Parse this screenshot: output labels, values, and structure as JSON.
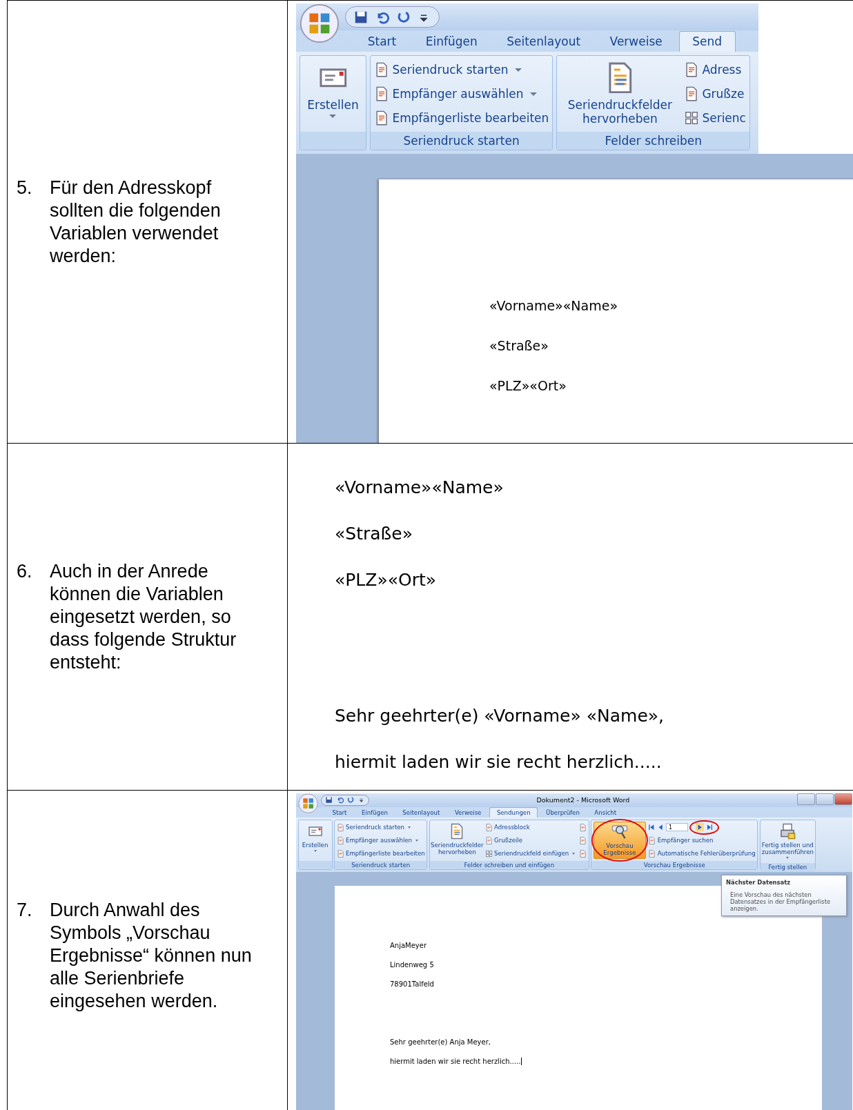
{
  "steps": [
    {
      "number": "5.",
      "text": "Für den Adresskopf sollten die folgenden Variablen verwendet werden:",
      "figure": {
        "kind": "ribbon_closeup",
        "tabs": [
          {
            "label": "Start",
            "selected": false
          },
          {
            "label": "Einfügen",
            "selected": false
          },
          {
            "label": "Seitenlayout",
            "selected": false
          },
          {
            "label": "Verweise",
            "selected": false
          },
          {
            "label": "Send",
            "selected": true
          }
        ],
        "groups": [
          {
            "items": [
              {
                "kind": "large",
                "label": "Erstellen",
                "dropdown": true
              }
            ]
          },
          {
            "label": "Seriendruck starten",
            "items": [
              {
                "kind": "small",
                "label": "Seriendruck starten",
                "dropdown": true
              },
              {
                "kind": "small",
                "label": "Empfänger auswählen",
                "dropdown": true
              },
              {
                "kind": "small",
                "label": "Empfängerliste bearbeiten",
                "dropdown": false
              }
            ]
          },
          {
            "label": "Felder schreiben",
            "items": [
              {
                "kind": "large",
                "label": "Seriendruckfelder hervorheben",
                "dropdown": false
              },
              {
                "kind": "small",
                "label": "Adress",
                "dropdown": false
              },
              {
                "kind": "small",
                "label": "Grußze",
                "dropdown": false
              },
              {
                "kind": "small",
                "label": "Serienc",
                "dropdown": false
              }
            ]
          }
        ],
        "blocks": [
          {
            "lines": [
              "«Vorname»«Name»",
              "«Straße»",
              "«PLZ»«Ort»"
            ]
          }
        ]
      }
    },
    {
      "number": "6.",
      "text": "Auch in der Anrede können die Variablen eingesetzt werden, so dass folgende Struktur entsteht:",
      "figure": {
        "kind": "document",
        "blocks": [
          {
            "lines": [
              "«Vorname»«Name»",
              "«Straße»",
              "«PLZ»«Ort»"
            ]
          },
          {
            "lines": [
              "Sehr geehrter(e) «Vorname» «Name»,",
              "hiermit laden wir sie recht herzlich....."
            ]
          }
        ]
      }
    },
    {
      "number": "7.",
      "text": "Durch Anwahl des Symbols „Vorschau Ergebnisse“ können nun alle Serienbriefe eingesehen werden.",
      "figure": {
        "kind": "word_window",
        "title": "Dokument2 - Microsoft Word",
        "tabs": [
          {
            "label": "Start",
            "selected": false
          },
          {
            "label": "Einfügen",
            "selected": false
          },
          {
            "label": "Seitenlayout",
            "selected": false
          },
          {
            "label": "Verweise",
            "selected": false
          },
          {
            "label": "Sendungen",
            "selected": true
          },
          {
            "label": "Überprüfen",
            "selected": false
          },
          {
            "label": "Ansicht",
            "selected": false
          }
        ],
        "groups": [
          {
            "items": [
              {
                "kind": "large",
                "label": "Erstellen",
                "dropdown": true
              }
            ]
          },
          {
            "label": "Seriendruck starten",
            "items": [
              {
                "kind": "small",
                "label": "Seriendruck starten",
                "dropdown": true
              },
              {
                "kind": "small",
                "label": "Empfänger auswählen",
                "dropdown": true
              },
              {
                "kind": "small",
                "label": "Empfängerliste bearbeiten",
                "dropdown": false
              }
            ]
          },
          {
            "label": "Felder schreiben und einfügen",
            "items": [
              {
                "kind": "large",
                "label": "Seriendruckfelder hervorheben",
                "dropdown": false
              },
              {
                "kind": "small",
                "label": "Adressblock",
                "dropdown": false
              },
              {
                "kind": "small",
                "label": "Grußzeile",
                "dropdown": false
              },
              {
                "kind": "small",
                "label": "Seriendruckfeld einfügen",
                "dropdown": true
              },
              {
                "kind": "icon"
              },
              {
                "kind": "icon"
              },
              {
                "kind": "icon"
              }
            ]
          },
          {
            "label": "Vorschau Ergebnisse",
            "items": [
              {
                "kind": "large",
                "label": "Vorschau Ergebnisse",
                "dropdown": false,
                "selected": true,
                "circled": true
              },
              {
                "kind": "nav",
                "value": "1",
                "circled": true
              },
              {
                "kind": "small",
                "label": "Empfänger suchen",
                "dropdown": false
              },
              {
                "kind": "small",
                "label": "Automatische Fehlerüberprüfung",
                "dropdown": false
              }
            ]
          },
          {
            "label": "Fertig stellen",
            "items": [
              {
                "kind": "large",
                "label": "Fertig stellen und zusammenführen",
                "dropdown": true
              }
            ]
          }
        ],
        "tooltip": {
          "title": "Nächster Datensatz",
          "text": "Eine Vorschau des nächsten Datensatzes in der Empfängerliste anzeigen."
        },
        "blocks": [
          {
            "lines": [
              "AnjaMeyer",
              "Lindenweg 5",
              "78901Talfeld"
            ]
          },
          {
            "lines": [
              "Sehr geehrter(e) Anja Meyer,",
              "hiermit laden wir sie recht herzlich....."
            ],
            "cursor_at_end": true
          }
        ]
      }
    }
  ]
}
